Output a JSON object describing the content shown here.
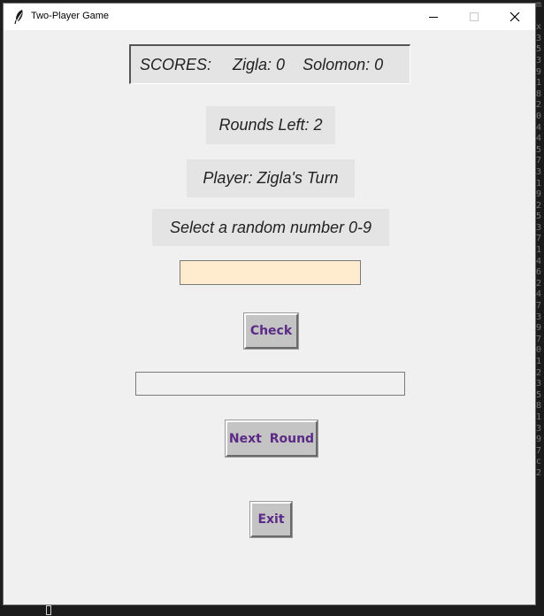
{
  "window": {
    "title": "Two-Player Game",
    "icon": "feather-icon"
  },
  "scores": {
    "label": "SCORES:",
    "player1": "Zigla: 0",
    "player2": "Solomon: 0"
  },
  "rounds_left": "Rounds Left: 2",
  "player_turn": "Player: Zigla's Turn",
  "prompt": "Select a random number 0-9",
  "guess_input": {
    "value": ""
  },
  "result_field": {
    "value": ""
  },
  "buttons": {
    "check": "Check",
    "next_round": "Next Round",
    "exit": "Exit"
  },
  "background_right_chars": [
    "m",
    "",
    "x",
    "3",
    "5",
    "3",
    "9",
    "1",
    "8",
    "2",
    "0",
    "4",
    "4",
    "5",
    "7",
    "3",
    "1",
    "9",
    "2",
    "5",
    "3",
    "7",
    "1",
    "4",
    "6",
    "2",
    "4",
    "7",
    "3",
    "9",
    "7",
    "0",
    "1",
    "2",
    "3",
    "5",
    "8",
    "1",
    "3",
    "9",
    "7",
    "c",
    "2"
  ],
  "colors": {
    "window_bg": "#f0f0f0",
    "label_bg": "#e4e4e4",
    "guess_bg": "#ffebcd",
    "button_bg": "#c4c4c4",
    "button_text": "#5b2a86"
  }
}
